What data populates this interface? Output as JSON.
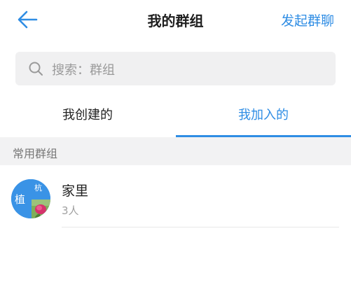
{
  "header": {
    "title": "我的群组",
    "action_label": "发起群聊",
    "accent_color": "#2f8de4"
  },
  "search": {
    "placeholder": "搜索：群组"
  },
  "tabs": [
    {
      "label": "我创建的",
      "active": false
    },
    {
      "label": "我加入的",
      "active": true
    }
  ],
  "section": {
    "label": "常用群组"
  },
  "groups": [
    {
      "name": "家里",
      "member_count": "3人",
      "avatar_chars": [
        "植",
        "杭"
      ]
    }
  ]
}
